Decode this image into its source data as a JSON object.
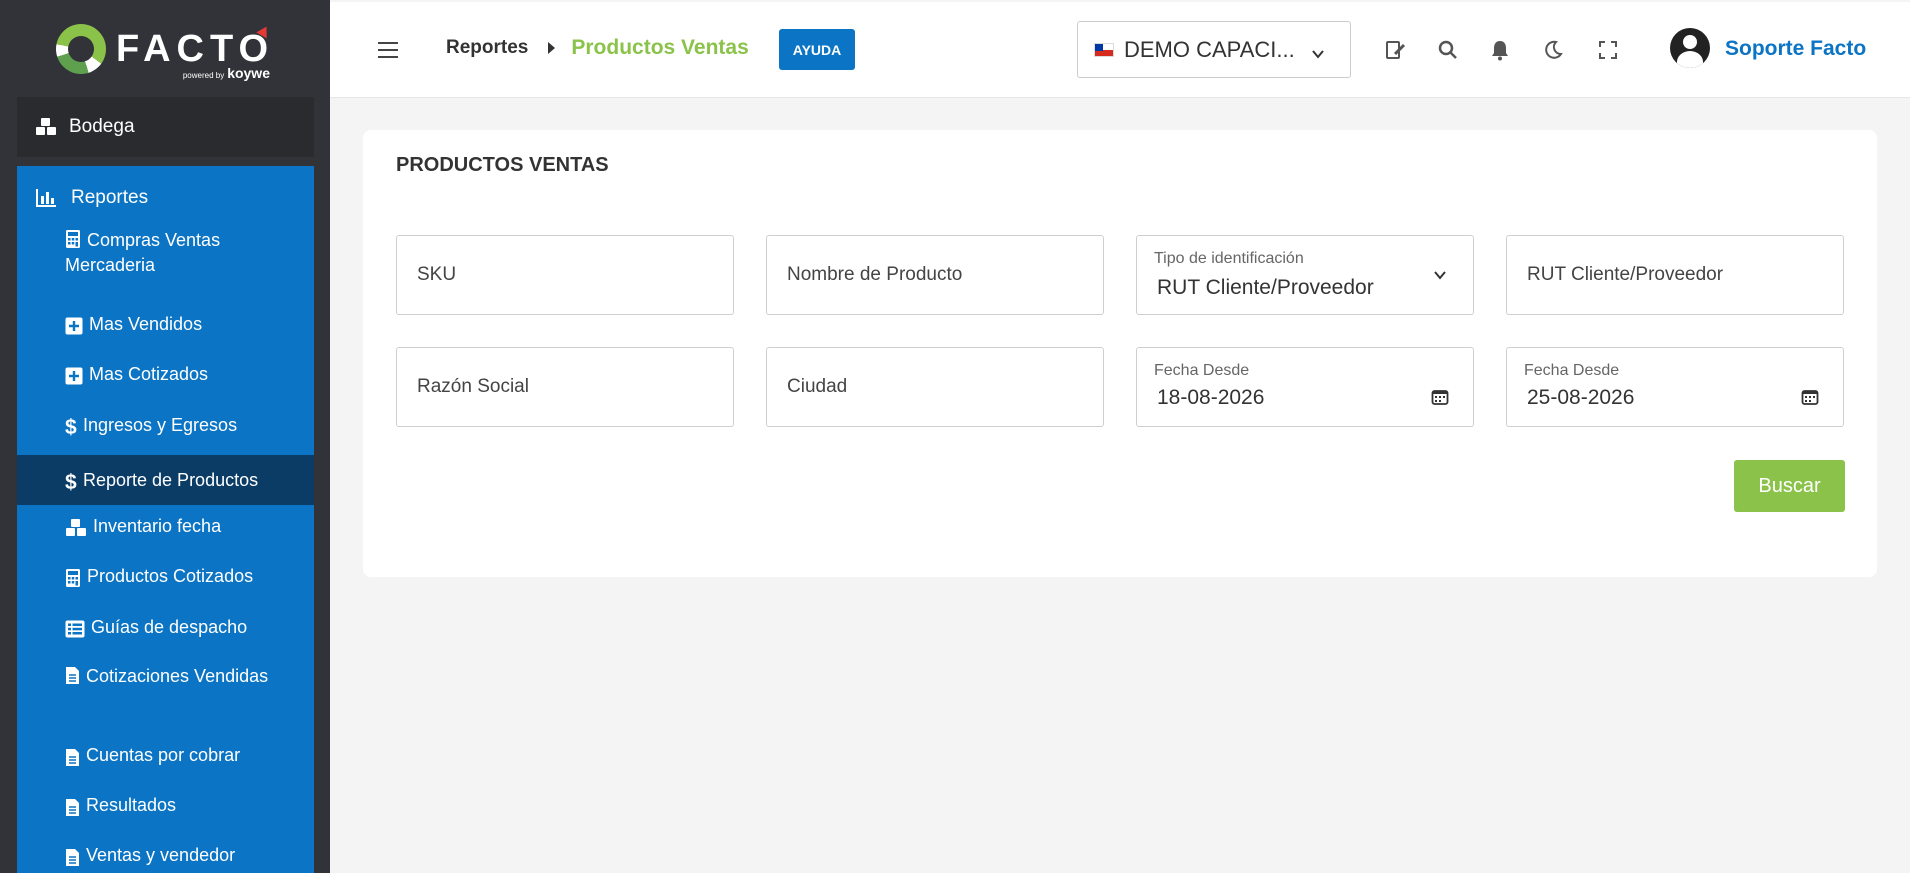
{
  "brand": {
    "name": "FACTO",
    "powered": "powered by",
    "partner": "koywe"
  },
  "sidebar": {
    "bodega_label": "Bodega",
    "reportes_label": "Reportes",
    "items": [
      {
        "label": "Compras Ventas Mercaderia",
        "icon": "calculator-icon"
      },
      {
        "label": "Mas Vendidos",
        "icon": "plus-square-icon"
      },
      {
        "label": "Mas Cotizados",
        "icon": "plus-square-icon"
      },
      {
        "label": "Ingresos y Egresos",
        "icon": "dollar-icon"
      },
      {
        "label": "Reporte de Productos",
        "icon": "dollar-icon",
        "active": true
      },
      {
        "label": "Inventario fecha",
        "icon": "cubes-icon"
      },
      {
        "label": "Productos Cotizados",
        "icon": "calculator-icon"
      },
      {
        "label": "Guías de despacho",
        "icon": "list-icon"
      },
      {
        "label": "Cotizaciones Vendidas",
        "icon": "document-icon"
      },
      {
        "label": "Cuentas por cobrar",
        "icon": "document-icon"
      },
      {
        "label": "Resultados",
        "icon": "document-icon"
      },
      {
        "label": "Ventas y vendedor",
        "icon": "document-icon"
      }
    ]
  },
  "header": {
    "breadcrumb_root": "Reportes",
    "breadcrumb_current": "Productos Ventas",
    "help_label": "AYUDA",
    "company": "DEMO CAPACI...",
    "user_name": "Soporte Facto"
  },
  "form": {
    "title": "PRODUCTOS VENTAS",
    "sku_placeholder": "SKU",
    "product_name_placeholder": "Nombre de Producto",
    "id_type_label": "Tipo de identificación",
    "id_type_value": "RUT Cliente/Proveedor",
    "rut_placeholder": "RUT Cliente/Proveedor",
    "razon_social_placeholder": "Razón Social",
    "ciudad_placeholder": "Ciudad",
    "date_from_label": "Fecha Desde",
    "date_from_value": "18-08-2026",
    "date_to_label": "Fecha Desde",
    "date_to_value": "25-08-2026",
    "search_label": "Buscar"
  },
  "colors": {
    "primary_blue": "#0b74c4",
    "active_dark": "#0b3c66",
    "accent_green": "#8bc34a",
    "sidebar_dark": "#313338"
  }
}
